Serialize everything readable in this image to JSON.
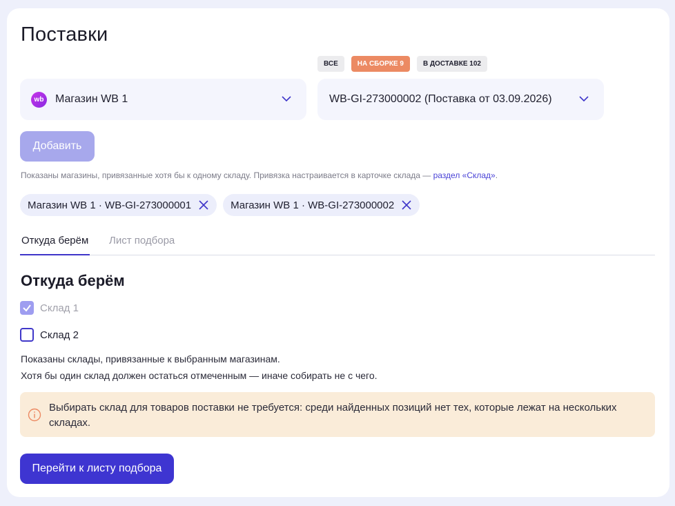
{
  "page": {
    "title": "Поставки"
  },
  "status_tabs": [
    {
      "label": "ВСЕ",
      "active": false
    },
    {
      "label": "НА СБОРКЕ 9",
      "active": true
    },
    {
      "label": "В ДОСТАВКЕ 102",
      "active": false
    }
  ],
  "shop_select": {
    "logo_text": "wb",
    "value": "Магазин WB 1"
  },
  "shipment_select": {
    "value": "WB-GI-273000002 (Поставка от 03.09.2026)"
  },
  "add_button": {
    "label": "Добавить"
  },
  "hint": {
    "text": "Показаны магазины, привязанные хотя бы к одному складу. Привязка настраивается в карточке склада — ",
    "link": "раздел «Склад»",
    "suffix": "."
  },
  "chips": [
    {
      "label": "Магазин WB 1 · WB-GI-273000001"
    },
    {
      "label": "Магазин WB 1 · WB-GI-273000002"
    }
  ],
  "tabs": [
    {
      "label": "Откуда берём",
      "active": true
    },
    {
      "label": "Лист подбора",
      "active": false
    }
  ],
  "section": {
    "title": "Откуда берём"
  },
  "warehouses": [
    {
      "label": "Склад 1",
      "checked": true,
      "disabled": true
    },
    {
      "label": "Склад 2",
      "checked": false,
      "disabled": false
    }
  ],
  "notes": {
    "line1": "Показаны склады, привязанные к выбранным магазинам.",
    "line2": "Хотя бы один склад должен остаться отмеченным — иначе собирать не с чего."
  },
  "alert": {
    "icon": "info-icon",
    "text": "Выбирать склад для товаров поставки не требуется: среди найденных позиций нет тех, которые лежат на нескольких складах."
  },
  "primary_button": {
    "label": "Перейти к листу подбора"
  },
  "colors": {
    "accent": "#3e35d1",
    "status_active": "#ec8a63",
    "alert_bg": "#faecd9",
    "link": "#4a43d6"
  }
}
